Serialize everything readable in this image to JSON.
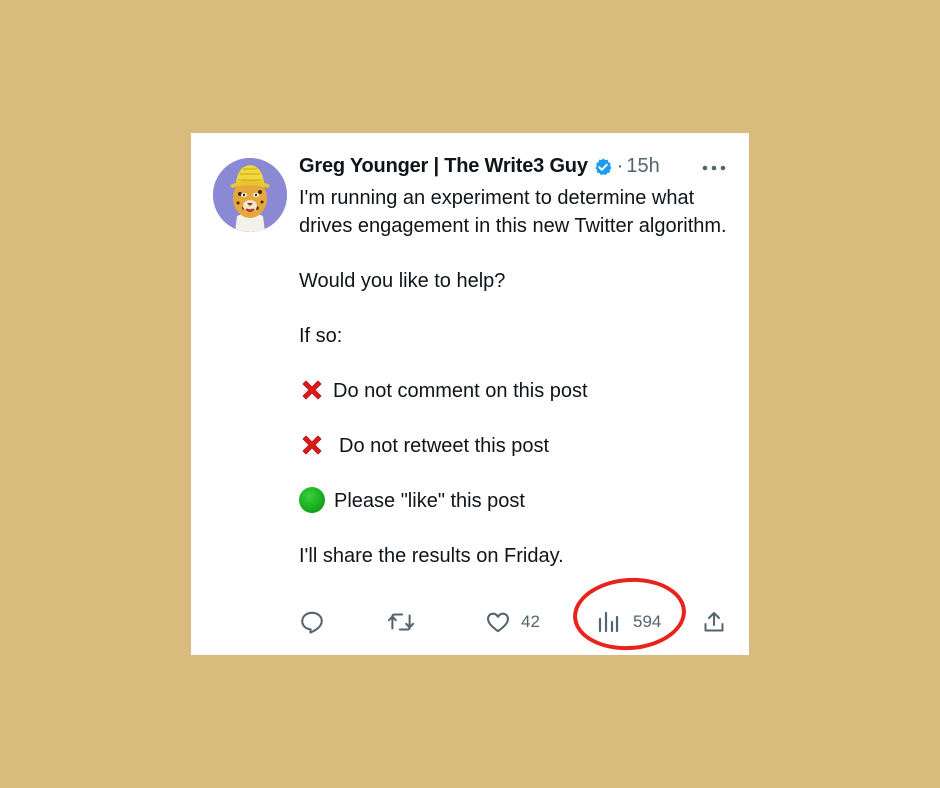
{
  "tweet": {
    "author_name": "Greg Younger | The Write3 Guy",
    "separator": "·",
    "time_ago": "15h",
    "lines": [
      "I'm running an experiment to determine what drives engagement in this new Twitter algorithm.",
      "Would you like to help?",
      "If so:",
      "Do not comment on this post",
      "Do not retweet this post",
      "Please \"like\" this post",
      "I'll share the results on Friday."
    ]
  },
  "actions": {
    "reply_icon": "reply-icon",
    "retweet_icon": "retweet-icon",
    "like_icon": "heart-icon",
    "like_count": "42",
    "views_icon": "views-chart-icon",
    "views_count": "594",
    "share_icon": "share-icon"
  },
  "colors": {
    "background": "#d9bb7e",
    "card": "#ffffff",
    "text": "#0f1419",
    "muted": "#536471",
    "verified": "#1d9bf0",
    "annotation": "#e8231b",
    "avatar_bg": "#8b88d4"
  }
}
